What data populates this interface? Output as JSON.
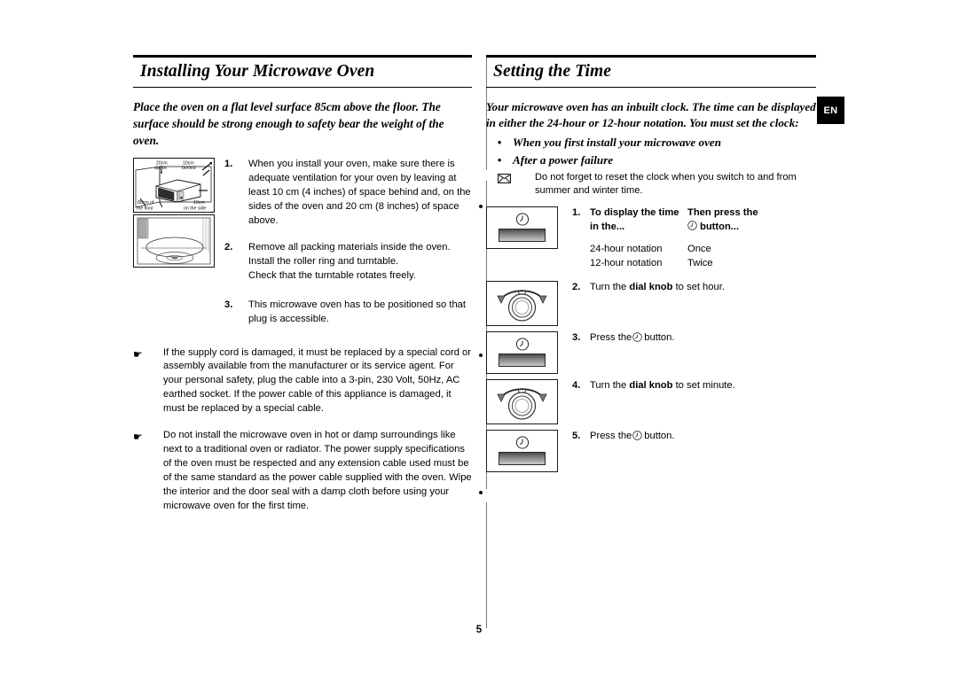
{
  "page": {
    "number": "5",
    "language_badge": "EN"
  },
  "left_column": {
    "heading": "Installing Your Microwave Oven",
    "intro": "Place the oven on a flat level surface 85cm above the floor. The surface should be strong enough to safety bear the weight of the oven.",
    "steps": [
      {
        "num": "1.",
        "text": "When you install your oven, make sure there is adequate ventilation for your oven by leaving at least 10 cm (4 inches) of space behind and, on the sides of the oven and 20 cm (8 inches) of space above."
      },
      {
        "num": "2.",
        "lines": [
          "Remove all packing materials inside the oven.",
          "Install the roller ring and turntable.",
          "Check that the turntable rotates freely."
        ]
      },
      {
        "num": "3.",
        "text": "This microwave oven has to be positioned so that plug is accessible."
      }
    ],
    "notices": [
      "If the supply cord is damaged, it must be replaced by a special cord or assembly available from the manufacturer or its service agent. For your personal safety, plug the cable into a 3-pin, 230 Volt, 50Hz, AC earthed socket. If the power cable of this appliance is damaged, it must be replaced by a special cable.",
      "Do not install the microwave oven in hot or damp surroundings like next to a traditional oven or radiator. The power supply specifications of the oven must be respected and any extension cable used must be of the same standard as the power cable supplied with the oven. Wipe the interior and the door seal with a damp cloth before using your microwave oven for the first time."
    ],
    "figure_labels": {
      "top_left": "20cm",
      "top_left_2": "above",
      "top_right": "10cm",
      "top_right_2": "behind",
      "bottom_left": "85cm of",
      "bottom_left_2": "the floor",
      "bottom_right": "10cm",
      "bottom_right_2": "on the side"
    }
  },
  "right_column": {
    "heading": "Setting the Time",
    "intro": "Your microwave oven has an inbuilt clock. The time can be displayed in either the 24-hour or 12-hour notation. You must set the clock:",
    "bullets": [
      "When you first install your microwave oven",
      "After a power failure"
    ],
    "note": "Do not forget to reset the clock when you switch to and from summer and winter time.",
    "steps": [
      {
        "num": "1.",
        "header_left": "To display the time",
        "header_left_2": "in the...",
        "header_right": "Then press the",
        "header_right_2": "button...",
        "rows": [
          {
            "left": "24-hour notation",
            "right": "Once"
          },
          {
            "left": "12-hour notation",
            "right": "Twice"
          }
        ]
      },
      {
        "num": "2.",
        "pre": "Turn the ",
        "bold": "dial knob",
        "post": " to set hour."
      },
      {
        "num": "3.",
        "pre": "Press the ",
        "post": " button."
      },
      {
        "num": "4.",
        "pre": "Turn the ",
        "bold": "dial knob",
        "post": " to set minute."
      },
      {
        "num": "5.",
        "pre": "Press the ",
        "post": " button."
      }
    ]
  },
  "icons": {
    "hand": "☛",
    "bullet": "•"
  },
  "colors": {
    "text": "#000000",
    "rule": "#000000",
    "badge_bg": "#000000",
    "badge_fg": "#ffffff"
  }
}
